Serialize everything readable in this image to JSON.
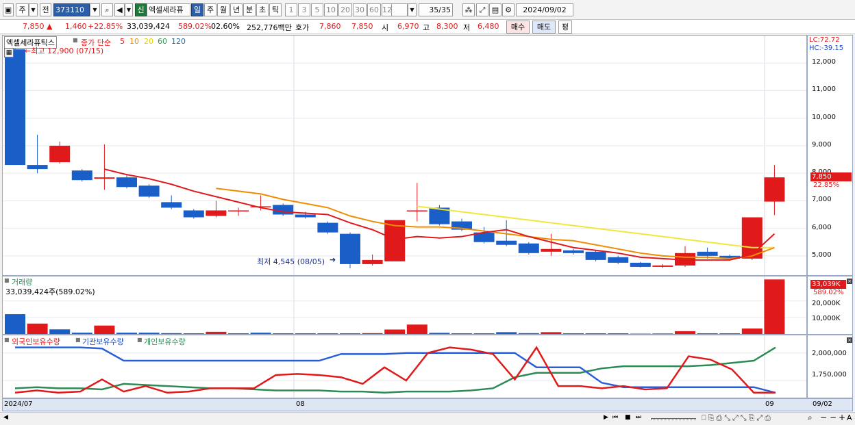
{
  "toolbar": {
    "mode": "주",
    "jeon": "전",
    "code": "373110",
    "new_badge": "신",
    "stock_name": "엑셀세라퓨",
    "periods": [
      "일",
      "주",
      "월",
      "년",
      "분",
      "초",
      "틱"
    ],
    "minutes": [
      "1",
      "3",
      "5",
      "10",
      "20",
      "30",
      "60",
      "120"
    ],
    "count": "35/35",
    "date": "2024/09/02"
  },
  "quote": {
    "price": "7,850",
    "change": "1,460",
    "change_pct": "+22.85%",
    "volume": "33,039,424",
    "volume_ratio": "589.02%",
    "turnover": "02.60%",
    "amount": "252,776백만",
    "hoga_label": "호가",
    "ask": "7,860",
    "bid": "7,850",
    "open_label": "시",
    "open": "6,970",
    "high_label": "고",
    "high": "8,300",
    "low_label": "저",
    "low": "6,480",
    "buy_label": "매수",
    "sell_label": "매도",
    "eval_label": "평"
  },
  "price_pane": {
    "title": "엑셀세라퓨틱스",
    "ma_label": "종가 단순",
    "ma_periods": [
      "5",
      "10",
      "20",
      "60",
      "120"
    ],
    "ma_colors": [
      "#e0191b",
      "#f08c00",
      "#f0e000",
      "#2c9a4a",
      "#1a4fc4"
    ],
    "high_note": "←최고 12,900 (07/15)",
    "low_note": "최저 4,545 (08/05)",
    "lc": "LC:72.72",
    "hc": "HC:-39.15",
    "current_tag": "7,850",
    "current_pct": "22.85%",
    "y_ticks": [
      "12,000",
      "11,000",
      "10,000",
      "9,000",
      "8,000",
      "7,000",
      "6,000",
      "5,000"
    ]
  },
  "volume_pane": {
    "title": "거래량",
    "summary": "33,039,424주(589.02%)",
    "tag": "33,039K",
    "tag_pct": "589.02%",
    "y_ticks": [
      "20,000K",
      "10,000K"
    ]
  },
  "holdings_pane": {
    "legend": [
      "외국인보유수량",
      "기관보유수량",
      "개인보유수량"
    ],
    "colors": [
      "#e0191b",
      "#1a4fc4",
      "#2c8a55"
    ],
    "y_ticks": [
      "2,000,000",
      "1,750,000"
    ]
  },
  "x_axis": {
    "labels": [
      "2024/07",
      "08",
      "09"
    ],
    "right_label": "09/02"
  },
  "chart_data": {
    "type": "candlestick",
    "dates_note": "daily candles 2024/07 - 2024/09/02",
    "candles": [
      {
        "o": 12500,
        "c": 8300,
        "h": 12900,
        "l": 8300
      },
      {
        "o": 8300,
        "c": 8150,
        "h": 9400,
        "l": 8000
      },
      {
        "o": 8400,
        "c": 9000,
        "h": 9150,
        "l": 8350
      },
      {
        "o": 8100,
        "c": 7750,
        "h": 8150,
        "l": 7700
      },
      {
        "o": 7800,
        "c": 7850,
        "h": 9050,
        "l": 7400
      },
      {
        "o": 7850,
        "c": 7500,
        "h": 7950,
        "l": 7450
      },
      {
        "o": 7550,
        "c": 7150,
        "h": 7600,
        "l": 7100
      },
      {
        "o": 6950,
        "c": 6750,
        "h": 7200,
        "l": 6700
      },
      {
        "o": 6650,
        "c": 6400,
        "h": 6700,
        "l": 6350
      },
      {
        "o": 6450,
        "c": 6650,
        "h": 7000,
        "l": 6400
      },
      {
        "o": 6650,
        "c": 6650,
        "h": 6750,
        "l": 6450
      },
      {
        "o": 6800,
        "c": 6800,
        "h": 7200,
        "l": 6650
      },
      {
        "o": 6850,
        "c": 6500,
        "h": 6900,
        "l": 6450
      },
      {
        "o": 6500,
        "c": 6400,
        "h": 6600,
        "l": 6350
      },
      {
        "o": 6200,
        "c": 5850,
        "h": 6250,
        "l": 5800
      },
      {
        "o": 5800,
        "c": 4700,
        "h": 5850,
        "l": 4545
      },
      {
        "o": 4700,
        "c": 4850,
        "h": 5050,
        "l": 4650
      },
      {
        "o": 4800,
        "c": 6300,
        "h": 6300,
        "l": 4800
      },
      {
        "o": 6650,
        "c": 6650,
        "h": 7650,
        "l": 6250
      },
      {
        "o": 6750,
        "c": 6150,
        "h": 6850,
        "l": 6100
      },
      {
        "o": 6250,
        "c": 5950,
        "h": 6350,
        "l": 5900
      },
      {
        "o": 5850,
        "c": 5500,
        "h": 6050,
        "l": 5450
      },
      {
        "o": 5550,
        "c": 5400,
        "h": 6300,
        "l": 5350
      },
      {
        "o": 5450,
        "c": 5100,
        "h": 5500,
        "l": 5050
      },
      {
        "o": 5150,
        "c": 5250,
        "h": 5800,
        "l": 5000
      },
      {
        "o": 5200,
        "c": 5100,
        "h": 5250,
        "l": 5050
      },
      {
        "o": 5150,
        "c": 4850,
        "h": 5200,
        "l": 4800
      },
      {
        "o": 4950,
        "c": 4750,
        "h": 5000,
        "l": 4700
      },
      {
        "o": 4750,
        "c": 4600,
        "h": 4780,
        "l": 4580
      },
      {
        "o": 4600,
        "c": 4650,
        "h": 4700,
        "l": 4560
      },
      {
        "o": 4650,
        "c": 5100,
        "h": 5350,
        "l": 4600
      },
      {
        "o": 5150,
        "c": 5000,
        "h": 5300,
        "l": 4900
      },
      {
        "o": 5000,
        "c": 4900,
        "h": 5050,
        "l": 4850
      },
      {
        "o": 4900,
        "c": 6400,
        "h": 6400,
        "l": 4850
      },
      {
        "o": 6970,
        "c": 7850,
        "h": 8300,
        "l": 6480
      }
    ],
    "ma5": [
      null,
      null,
      null,
      null,
      8150,
      7950,
      7800,
      7600,
      7350,
      7150,
      6950,
      6750,
      6600,
      6550,
      6500,
      6200,
      5950,
      5600,
      5700,
      5650,
      5700,
      5850,
      5950,
      5700,
      5500,
      5300,
      5200,
      5100,
      4950,
      4900,
      4850,
      4850,
      4850,
      5050,
      5800
    ],
    "ma10": [
      null,
      null,
      null,
      null,
      null,
      null,
      null,
      null,
      null,
      7450,
      7350,
      7250,
      7050,
      6900,
      6750,
      6450,
      6250,
      6100,
      6050,
      6050,
      6000,
      5900,
      5800,
      5700,
      5600,
      5550,
      5400,
      5250,
      5100,
      5000,
      4950,
      4950,
      4900,
      5000,
      5300
    ],
    "ma20": [
      null,
      null,
      null,
      null,
      null,
      null,
      null,
      null,
      null,
      null,
      null,
      null,
      null,
      null,
      null,
      null,
      null,
      null,
      6800,
      6700,
      6600,
      6500,
      6400,
      6300,
      6200,
      6100,
      6000,
      5900,
      5800,
      5700,
      5600,
      5500,
      5400,
      5300,
      5300
    ],
    "volume_k": [
      12000,
      6300,
      2800,
      800,
      5100,
      800,
      800,
      500,
      400,
      1300,
      400,
      800,
      400,
      400,
      400,
      400,
      500,
      2700,
      5700,
      700,
      400,
      400,
      1100,
      500,
      1100,
      400,
      400,
      400,
      200,
      300,
      1700,
      400,
      400,
      3300,
      33039
    ],
    "volume_up": [
      false,
      true,
      false,
      false,
      true,
      false,
      false,
      false,
      false,
      true,
      false,
      false,
      false,
      false,
      false,
      false,
      true,
      true,
      true,
      false,
      false,
      false,
      false,
      false,
      true,
      false,
      false,
      false,
      false,
      true,
      true,
      false,
      false,
      true,
      true
    ],
    "foreign": [
      1640000,
      1660000,
      1640000,
      1650000,
      1760000,
      1650000,
      1700000,
      1640000,
      1650000,
      1680000,
      1680000,
      1680000,
      1800000,
      1810000,
      1800000,
      1780000,
      1720000,
      1870000,
      1750000,
      2000000,
      2050000,
      2030000,
      1990000,
      1760000,
      2050000,
      1700000,
      1700000,
      1680000,
      1700000,
      1670000,
      1680000,
      1970000,
      1940000,
      1850000,
      1640000,
      1640000
    ],
    "institution": [
      2050000,
      2050000,
      2050000,
      2050000,
      2040000,
      1930000,
      1930000,
      1930000,
      1930000,
      1930000,
      1930000,
      1930000,
      1930000,
      1930000,
      1930000,
      1990000,
      1990000,
      1990000,
      2000000,
      2000000,
      2000000,
      2000000,
      2000000,
      2000000,
      1870000,
      1870000,
      1870000,
      1730000,
      1690000,
      1690000,
      1690000,
      1690000,
      1690000,
      1690000,
      1690000,
      1640000
    ],
    "individual": [
      1680000,
      1690000,
      1680000,
      1680000,
      1670000,
      1720000,
      1710000,
      1700000,
      1690000,
      1680000,
      1680000,
      1670000,
      1660000,
      1660000,
      1660000,
      1650000,
      1650000,
      1640000,
      1650000,
      1650000,
      1650000,
      1660000,
      1680000,
      1780000,
      1820000,
      1820000,
      1820000,
      1860000,
      1880000,
      1880000,
      1880000,
      1880000,
      1890000,
      1910000,
      1930000,
      2050000
    ],
    "price_ylim": [
      4300,
      13000
    ],
    "volume_ylim": [
      0,
      34000
    ],
    "holdings_ylim": [
      1620000,
      2110000
    ]
  }
}
